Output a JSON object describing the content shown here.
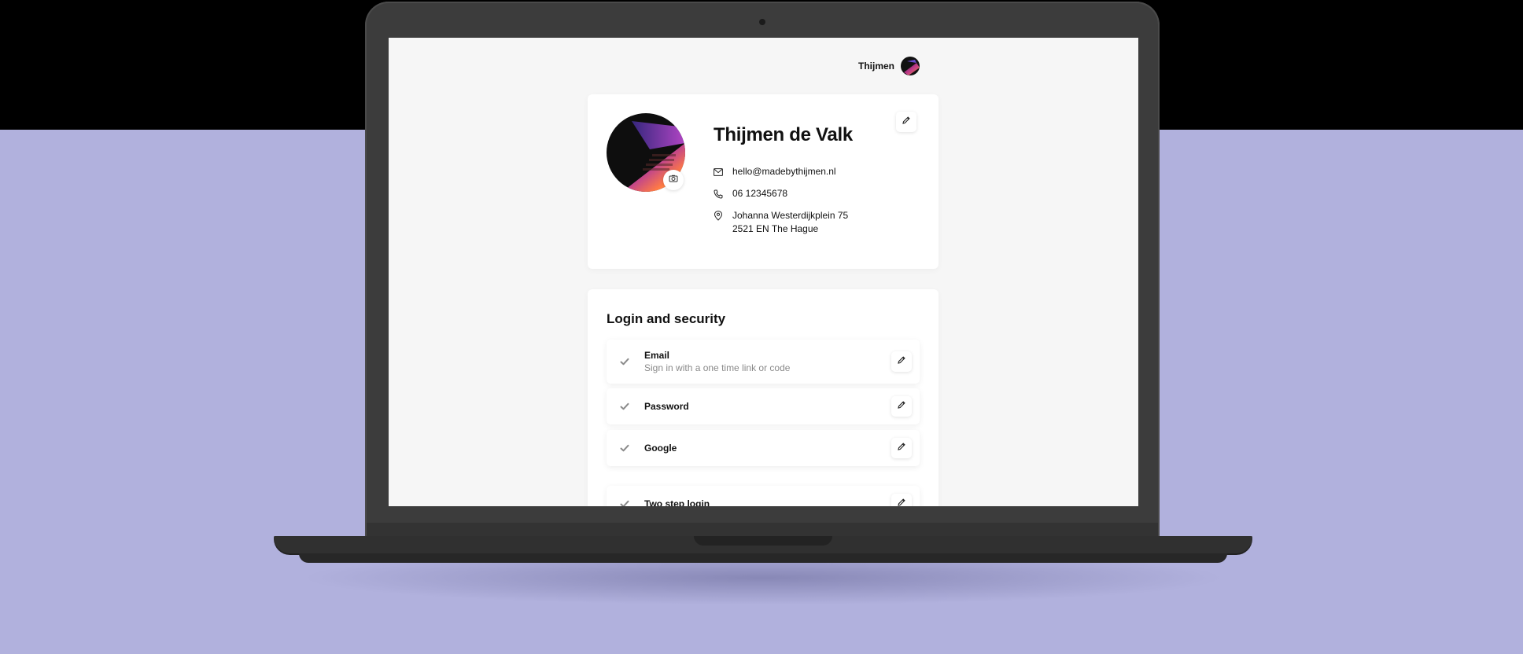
{
  "header": {
    "user_name": "Thijmen"
  },
  "profile": {
    "name": "Thijmen de Valk",
    "email": "hello@madebythijmen.nl",
    "phone": "06 12345678",
    "address_line1": "Johanna Westerdijkplein 75",
    "address_line2": "2521 EN The Hague"
  },
  "security": {
    "title": "Login and security",
    "items": [
      {
        "title": "Email",
        "subtitle": "Sign in with a one time link or code"
      },
      {
        "title": "Password",
        "subtitle": ""
      },
      {
        "title": "Google",
        "subtitle": ""
      },
      {
        "title": "Two step login",
        "subtitle": ""
      }
    ]
  },
  "colors": {
    "page_bg": "#b1b1dd",
    "top_band": "#000000",
    "laptop": "#3c3c3c",
    "screen_bg": "#f6f6f6",
    "text": "#111111",
    "muted": "#8a8a8a"
  },
  "icons": [
    "camera-icon",
    "pencil-icon",
    "mail-icon",
    "phone-icon",
    "location-pin-icon",
    "check-icon"
  ]
}
